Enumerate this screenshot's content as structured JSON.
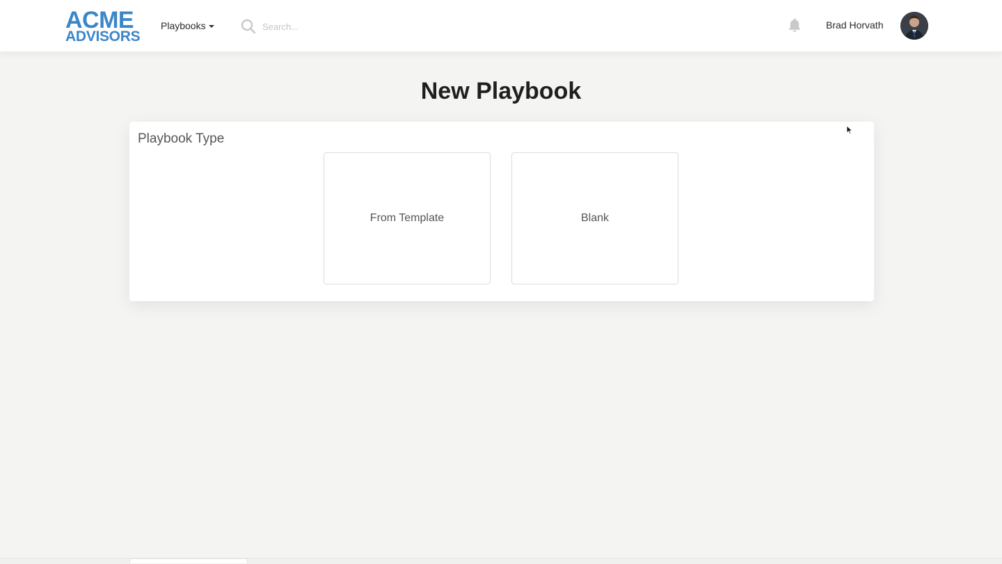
{
  "brand": {
    "line1": "ACME",
    "line2": "ADVISORS",
    "color": "#3a86c8"
  },
  "nav": {
    "dropdown_label": "Playbooks"
  },
  "search": {
    "placeholder": "Search..."
  },
  "user": {
    "name": "Brad Horvath"
  },
  "page": {
    "title": "New Playbook"
  },
  "card": {
    "label": "Playbook Type",
    "options": [
      {
        "label": "From Template"
      },
      {
        "label": "Blank"
      }
    ]
  },
  "icons": {
    "search": "search-icon",
    "notifications": "bell-icon",
    "dropdown": "caret-down-icon"
  }
}
